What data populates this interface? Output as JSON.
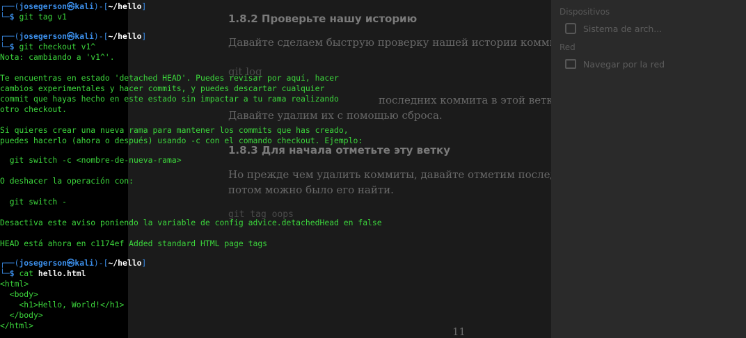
{
  "document": {
    "h1": "1.8.2  Проверьте нашу историю",
    "p1": "Давайте сделаем быструю проверку нашей истории коммитов.",
    "p2a": "git  log",
    "p2b": "последних коммита в этой ветке —",
    "p2c": "Давайте удалим их с помощью сброса.",
    "h2": "1.8.3  Для начала отметьте эту ветку",
    "p3a": "Но прежде чем удалить коммиты, давайте отметим последний",
    "p3b": "потом можно было его найти.",
    "p4": "git tag oops",
    "page_number": "11"
  },
  "sidebar": {
    "devices_label": "Dispositivos",
    "filesystem": "Sistema de arch...",
    "network_label": "Red",
    "browse_network": "Navegar por la red"
  },
  "terminal": {
    "prompt_user": "josegerson",
    "prompt_at": "㉿",
    "prompt_host": "kali",
    "prompt_path": "~/hello",
    "cmd1": "git tag v1",
    "cmd2": "git checkout v1^",
    "out_lines": [
      "Nota: cambiando a 'v1^'.",
      "",
      "Te encuentras en estado 'detached HEAD'. Puedes revisar por aquí, hacer",
      "cambios experimentales y hacer commits, y puedes descartar cualquier",
      "commit que hayas hecho en este estado sin impactar a tu rama realizando",
      "otro checkout.",
      "",
      "Si quieres crear una nueva rama para mantener los commits que has creado,",
      "puedes hacerlo (ahora o después) usando -c con el comando checkout. Ejemplo:",
      "",
      "  git switch -c <nombre-de-nueva-rama>",
      "",
      "O deshacer la operación con:",
      "",
      "  git switch -",
      "",
      "Desactiva este aviso poniendo la variable de config advice.detachedHead en false",
      "",
      "HEAD está ahora en c1174ef Added standard HTML page tags"
    ],
    "cmd3_name": "cat",
    "cmd3_arg": "hello.html",
    "file_lines": [
      "<html>",
      "  <body>",
      "    <h1>Hello, World!</h1>",
      "  </body>",
      "</html>"
    ]
  }
}
